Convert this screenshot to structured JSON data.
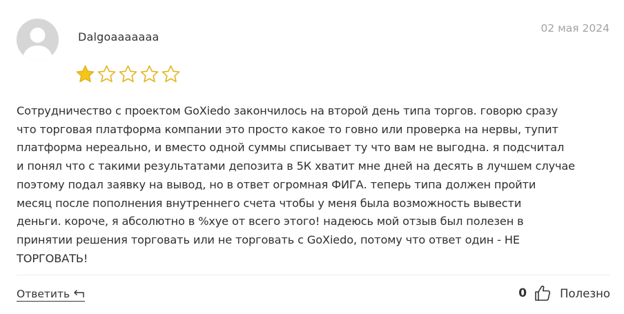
{
  "review": {
    "author": "Dalgoaaaaaaa",
    "date": "02 мая 2024",
    "rating": 1,
    "rating_max": 5,
    "text": "Сотрудничество с проектом GoXiedo закончилось на второй день типа торгов. говорю сразу\nчто торговая платформа компании это просто какое то говно или проверка на нервы, тупит\nплатформа нереально, и вместо одной суммы списывает ту что вам не выгодна. я подсчитал\nи понял что с такими результатами депозита в 5К хватит мне дней на десять в лучшем случае\nпоэтому подал заявку на вывод, но в ответ огромная ФИГА. теперь типа должен пройти\nмесяц после пополнения внутреннего счета чтобы у меня была возможность вывести\nденьги. короче, я абсолютно в %хуе от всего этого! надеюсь мой отзыв был полезен в\nпринятии решения торговать или не торговать с GoXiedo, потому что ответ один - НЕ\nТОРГОВАТЬ!"
  },
  "actions": {
    "reply_label": "Ответить",
    "helpful_count": "0",
    "helpful_label": "Полезно"
  },
  "colors": {
    "star_filled": "#f5c518",
    "star_outline": "#e3b41c",
    "avatar_bg": "#d6d6d6",
    "date": "#a3a3a3"
  },
  "icons": {
    "avatar": "user-avatar-icon",
    "reply": "reply-arrow-icon",
    "like": "thumbs-up-icon",
    "star": "star-icon"
  }
}
